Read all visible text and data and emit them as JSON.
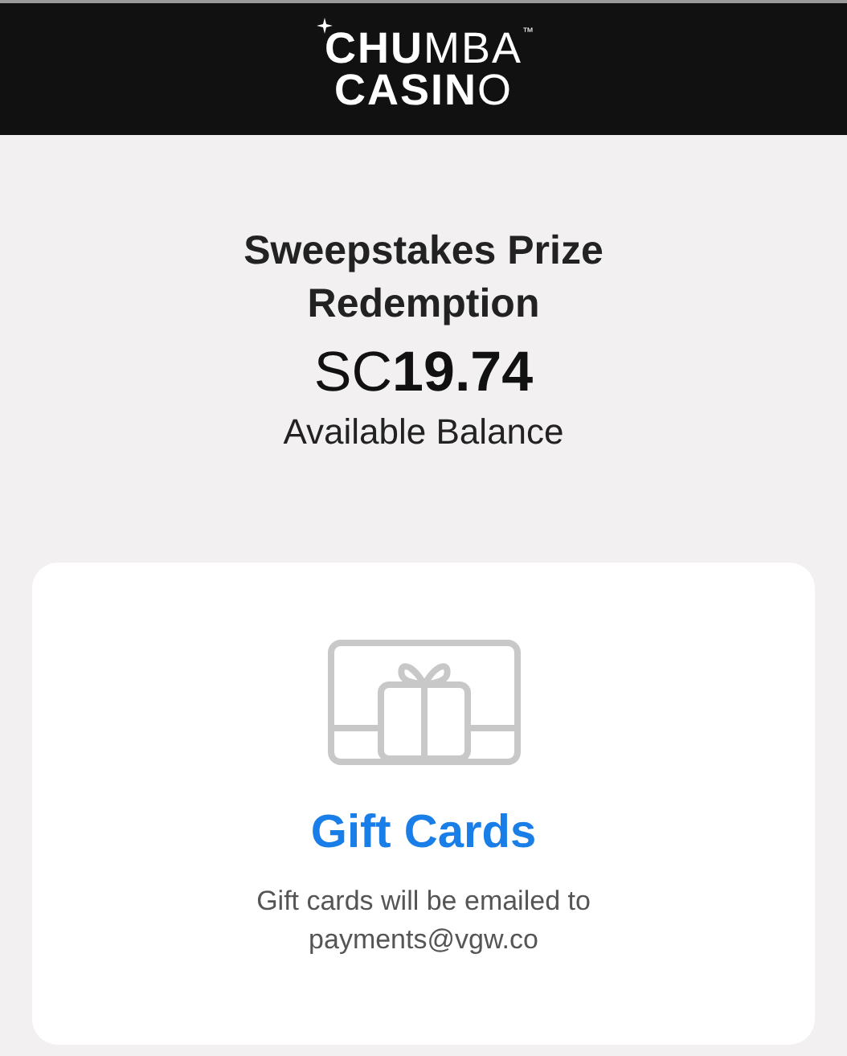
{
  "header": {
    "logo_lines": [
      "**CHU**MBA",
      "**CASIN**O"
    ],
    "trademark": "™"
  },
  "title": "Sweepstakes Prize Redemption",
  "balance": {
    "currency": "SC",
    "amount": "19.74",
    "label": "Available Balance"
  },
  "card": {
    "title": "Gift Cards",
    "description": "Gift cards will be emailed to payments@vgw.co"
  }
}
